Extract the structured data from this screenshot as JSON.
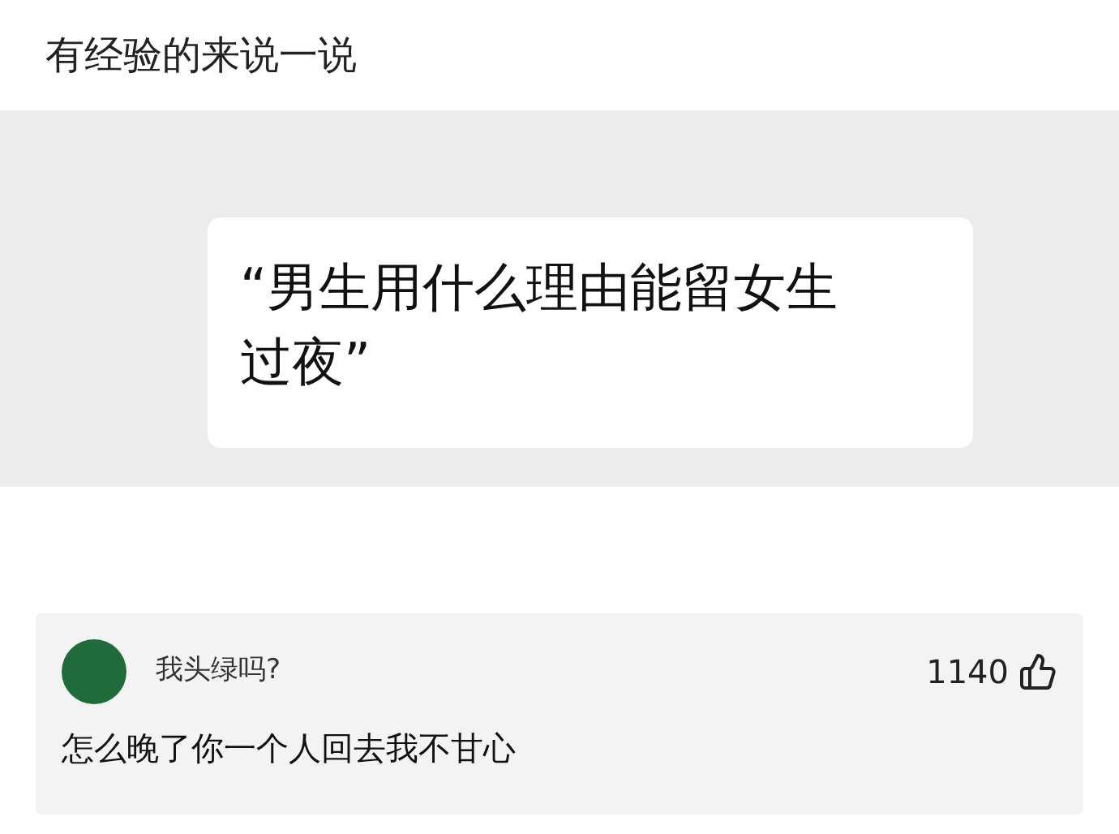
{
  "title": "有经验的来说一说",
  "quote": {
    "text": "“男生用什么理由能留女生过夜”"
  },
  "comment": {
    "author": "我头绿吗?",
    "likes": "1140",
    "text": "怎么晚了你一个人回去我不甘心"
  }
}
